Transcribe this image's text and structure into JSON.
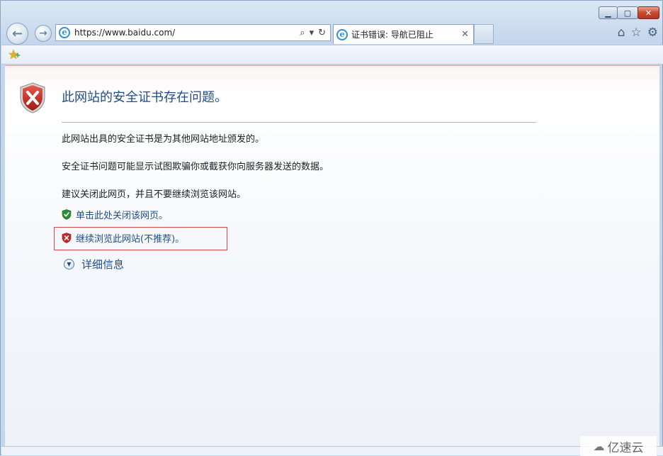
{
  "window": {
    "min_glyph": "▁",
    "max_glyph": "▢",
    "close_glyph": "✕"
  },
  "nav": {
    "back_glyph": "←",
    "forward_glyph": "→",
    "address_url": "https://www.baidu.com/",
    "search_glyph": "⌕",
    "dropdown_glyph": "▾",
    "refresh_glyph": "↻",
    "tab_title": "证书错误: 导航已阻止",
    "tab_close_glyph": "✕",
    "home_glyph": "⌂",
    "favorites_glyph": "☆",
    "tools_glyph": "⚙"
  },
  "favorites_bar": {
    "icon": "add-favorite-star-icon"
  },
  "content": {
    "title": "此网站的安全证书存在问题。",
    "para1": "此网站出具的安全证书是为其他网站地址颁发的。",
    "para2": "安全证书问题可能显示试图欺骗你或截获你向服务器发送的数据。",
    "para3": "建议关闭此网页，并且不要继续浏览该网站。",
    "close_link": "单击此处关闭该网页。",
    "continue_link": "继续浏览此网站(不推荐)。",
    "details_link": "详细信息",
    "details_glyph": "▼"
  },
  "watermark": {
    "text": "亿速云",
    "glyph": "☁"
  },
  "colors": {
    "link": "#1f4b8c",
    "highlight_border": "#d44a4a",
    "shield_red": "#c62828",
    "shield_green": "#2e8b3a"
  }
}
